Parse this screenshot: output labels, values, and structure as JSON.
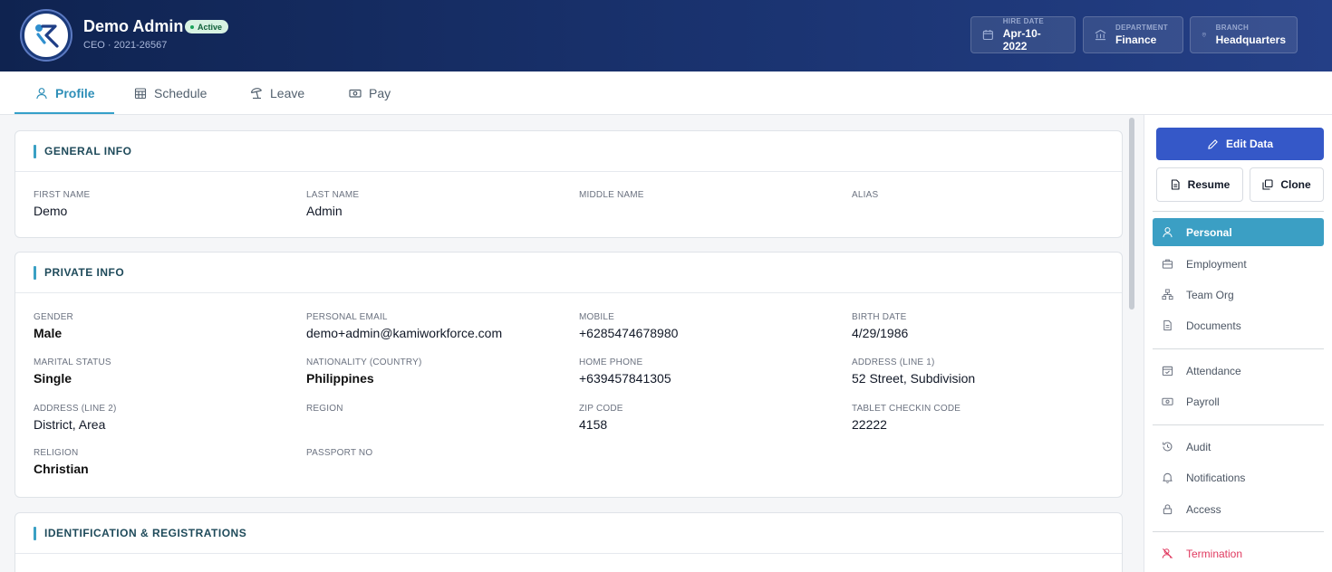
{
  "header": {
    "name": "Demo Admin",
    "status": "Active",
    "subtitle": "CEO · 2021-26567",
    "chips": [
      {
        "label": "HIRE DATE",
        "value": "Apr-10-2022",
        "icon": "calendar-icon"
      },
      {
        "label": "DEPARTMENT",
        "value": "Finance",
        "icon": "building-icon"
      },
      {
        "label": "BRANCH",
        "value": "Headquarters",
        "icon": "location-pin-icon"
      }
    ]
  },
  "tabs": [
    {
      "label": "Profile",
      "icon": "user-icon",
      "active": true
    },
    {
      "label": "Schedule",
      "icon": "grid-calendar-icon"
    },
    {
      "label": "Leave",
      "icon": "beach-umbrella-icon"
    },
    {
      "label": "Pay",
      "icon": "cash-icon"
    }
  ],
  "general": {
    "title": "GENERAL INFO",
    "fields": [
      {
        "label": "FIRST NAME",
        "value": "Demo"
      },
      {
        "label": "LAST NAME",
        "value": "Admin"
      },
      {
        "label": "MIDDLE NAME",
        "value": ""
      },
      {
        "label": "ALIAS",
        "value": ""
      }
    ]
  },
  "private": {
    "title": "PRIVATE INFO",
    "fields": [
      {
        "label": "GENDER",
        "value": "Male"
      },
      {
        "label": "PERSONAL EMAIL",
        "value": "demo+admin@kamiworkforce.com"
      },
      {
        "label": "MOBILE",
        "value": "+6285474678980"
      },
      {
        "label": "BIRTH DATE",
        "value": "4/29/1986"
      },
      {
        "label": "MARITAL STATUS",
        "value": "Single"
      },
      {
        "label": "NATIONALITY (COUNTRY)",
        "value": "Philippines"
      },
      {
        "label": "HOME PHONE",
        "value": "+639457841305"
      },
      {
        "label": "ADDRESS (LINE 1)",
        "value": "52 Street, Subdivision"
      },
      {
        "label": "ADDRESS (LINE 2)",
        "value": "District, Area"
      },
      {
        "label": "REGION",
        "value": ""
      },
      {
        "label": "ZIP CODE",
        "value": "4158"
      },
      {
        "label": "TABLET CHECKIN CODE",
        "value": "22222"
      },
      {
        "label": "RELIGION",
        "value": "Christian"
      },
      {
        "label": "PASSPORT NO",
        "value": ""
      }
    ]
  },
  "identification": {
    "title": "IDENTIFICATION & REGISTRATIONS"
  },
  "side": {
    "edit_label": "Edit Data",
    "resume_label": "Resume",
    "clone_label": "Clone",
    "nav": [
      {
        "label": "Personal",
        "icon": "user-icon",
        "active": true
      },
      {
        "label": "Employment",
        "icon": "briefcase-icon"
      },
      {
        "label": "Team Org",
        "icon": "org-chart-icon"
      },
      {
        "label": "Documents",
        "icon": "document-icon"
      },
      {
        "label": "Attendance",
        "icon": "calendar-check-icon"
      },
      {
        "label": "Payroll",
        "icon": "cash-icon"
      },
      {
        "label": "Audit",
        "icon": "history-icon"
      },
      {
        "label": "Notifications",
        "icon": "bell-icon"
      },
      {
        "label": "Access",
        "icon": "lock-icon"
      },
      {
        "label": "Termination",
        "icon": "user-remove-icon",
        "danger": true
      }
    ]
  },
  "colors": {
    "accent": "#3b9fc4",
    "primary_button": "#3558c8",
    "header": "#14295e",
    "danger": "#e0395f"
  }
}
